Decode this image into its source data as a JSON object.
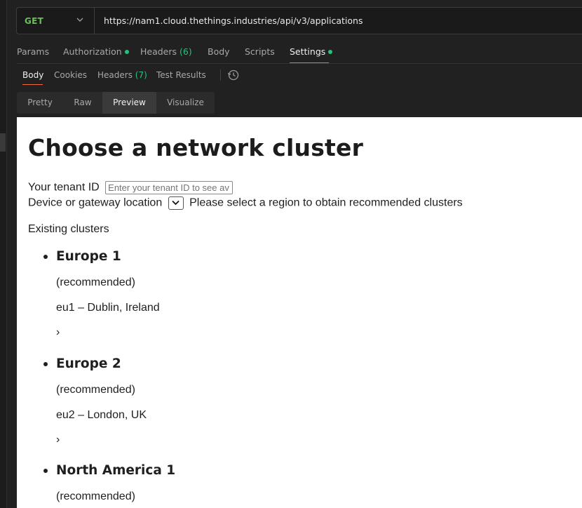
{
  "request": {
    "method": "GET",
    "url": "https://nam1.cloud.thethings.industries/api/v3/applications"
  },
  "request_tabs": [
    {
      "label": "Params",
      "count": "",
      "dot": false,
      "active": false
    },
    {
      "label": "Authorization",
      "count": "",
      "dot": true,
      "active": false
    },
    {
      "label": "Headers",
      "count": "(6)",
      "dot": false,
      "active": false
    },
    {
      "label": "Body",
      "count": "",
      "dot": false,
      "active": false
    },
    {
      "label": "Scripts",
      "count": "",
      "dot": false,
      "active": false
    },
    {
      "label": "Settings",
      "count": "",
      "dot": true,
      "active": true
    }
  ],
  "response_tabs": [
    {
      "label": "Body",
      "count": "",
      "active": true
    },
    {
      "label": "Cookies",
      "count": "",
      "active": false
    },
    {
      "label": "Headers",
      "count": "(7)",
      "active": false
    },
    {
      "label": "Test Results",
      "count": "",
      "active": false
    }
  ],
  "view_modes": [
    {
      "label": "Pretty",
      "active": false
    },
    {
      "label": "Raw",
      "active": false
    },
    {
      "label": "Preview",
      "active": true
    },
    {
      "label": "Visualize",
      "active": false
    }
  ],
  "preview": {
    "title": "Choose a network cluster",
    "tenant_label": "Your tenant ID",
    "tenant_placeholder": "Enter your tenant ID to see av",
    "location_label": "Device or gateway location",
    "location_hint": "Please select a region to obtain recommended clusters",
    "existing_label": "Existing clusters",
    "clusters": [
      {
        "name": "Europe 1",
        "tag": "(recommended)",
        "location": "eu1 – Dublin, Ireland",
        "chevron": "›"
      },
      {
        "name": "Europe 2",
        "tag": "(recommended)",
        "location": "eu2 – London, UK",
        "chevron": "›"
      },
      {
        "name": "North America 1",
        "tag": "(recommended)",
        "location": "",
        "chevron": ""
      }
    ]
  },
  "colors": {
    "method_get": "#6bbf59",
    "indicator_green": "#27c27a",
    "active_underline": "#f26b3a"
  },
  "icons": {
    "method_dropdown": "chevron-down-icon",
    "history": "history-icon",
    "select_arrow": "chevron-down-icon"
  }
}
